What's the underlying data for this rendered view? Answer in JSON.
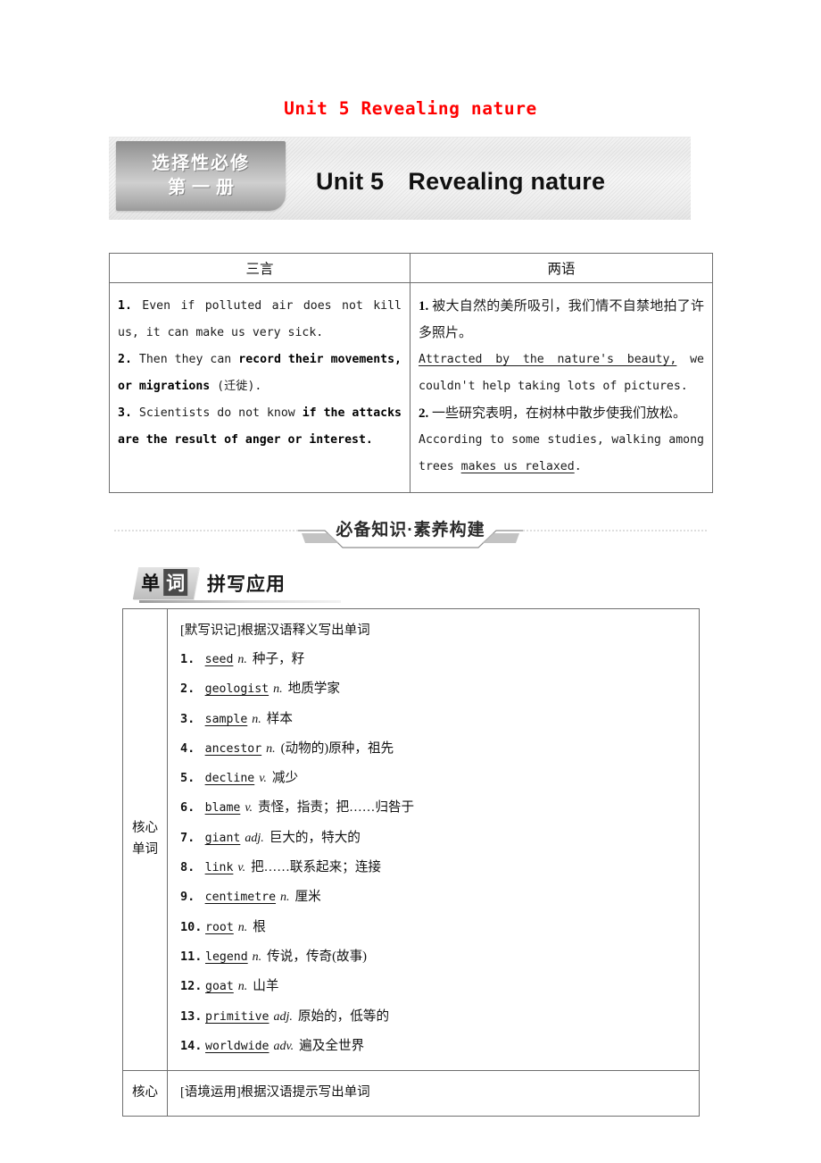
{
  "running_head": "Unit 5 Revealing nature",
  "banner": {
    "tab_line1": "选择性必修",
    "tab_line2": "第一册",
    "title": "Unit 5　Revealing nature"
  },
  "sentence_table": {
    "headers": [
      "三言",
      "两语"
    ],
    "left_items": [
      {
        "num": "1.",
        "segments": [
          {
            "text": "Even if polluted air does not kill us, it can make us very sick.",
            "bold": false
          }
        ]
      },
      {
        "num": "2.",
        "segments": [
          {
            "text": "Then they can ",
            "bold": false
          },
          {
            "text": "record their movements, or migrations",
            "bold": true
          },
          {
            "text": " (迁徙).",
            "bold": false
          }
        ]
      },
      {
        "num": "3.",
        "segments": [
          {
            "text": "Scientists do not know ",
            "bold": false
          },
          {
            "text": "if the attacks are the result of anger or interest.",
            "bold": true
          }
        ]
      }
    ],
    "right_items": [
      {
        "num": "1.",
        "chinese": "被大自然的美所吸引，我们情不自禁地拍了许多照片。",
        "english_underlined": "Attracted by the nature's beauty,",
        "english_rest": " we couldn't help taking lots of pictures."
      },
      {
        "num": "2.",
        "chinese": "一些研究表明，在树林中散步使我们放松。",
        "english_pre": "According to some studies, walking among trees ",
        "english_underlined": "makes us relaxed",
        "english_post": "."
      }
    ]
  },
  "section_divider": {
    "label": "必备知识·素养构建"
  },
  "word_heading": {
    "badge_char1": "单",
    "badge_char2": "词",
    "text": "拼写应用"
  },
  "vocab_table": {
    "row_label_core": "核心\n单词",
    "row_label_context": "核心",
    "intro": "[默写识记]根据汉语释义写出单词",
    "items": [
      {
        "num": "1.",
        "word": "seed",
        "pos": "n.",
        "meaning": "种子，籽"
      },
      {
        "num": "2.",
        "word": "geologist",
        "pos": "n.",
        "meaning": "地质学家"
      },
      {
        "num": "3.",
        "word": "sample",
        "pos": "n.",
        "meaning": "样本"
      },
      {
        "num": "4.",
        "word": "ancestor",
        "pos": "n.",
        "meaning": "(动物的)原种，祖先"
      },
      {
        "num": "5.",
        "word": "decline",
        "pos": "v.",
        "meaning": "减少"
      },
      {
        "num": "6.",
        "word": "blame",
        "pos": "v.",
        "meaning": "责怪，指责；把……归咎于"
      },
      {
        "num": "7.",
        "word": "giant",
        "pos": "adj.",
        "meaning": "巨大的，特大的"
      },
      {
        "num": "8.",
        "word": "link",
        "pos": "v.",
        "meaning": "把……联系起来；连接"
      },
      {
        "num": "9.",
        "word": "centimetre",
        "pos": "n.",
        "meaning": "厘米"
      },
      {
        "num": "10.",
        "word": "root",
        "pos": "n.",
        "meaning": "根"
      },
      {
        "num": "11.",
        "word": "legend",
        "pos": "n.",
        "meaning": "传说，传奇(故事)"
      },
      {
        "num": "12.",
        "word": "goat",
        "pos": "n.",
        "meaning": "山羊"
      },
      {
        "num": "13.",
        "word": "primitive",
        "pos": "adj.",
        "meaning": "原始的，低等的"
      },
      {
        "num": "14.",
        "word": "worldwide",
        "pos": "adv.",
        "meaning": "遍及全世界"
      }
    ],
    "context_intro": "[语境运用]根据汉语提示写出单词"
  },
  "colors": {
    "running_head": "#ff0000",
    "border": "#6f6f6f",
    "tab_gray": "#bdbdbd"
  }
}
